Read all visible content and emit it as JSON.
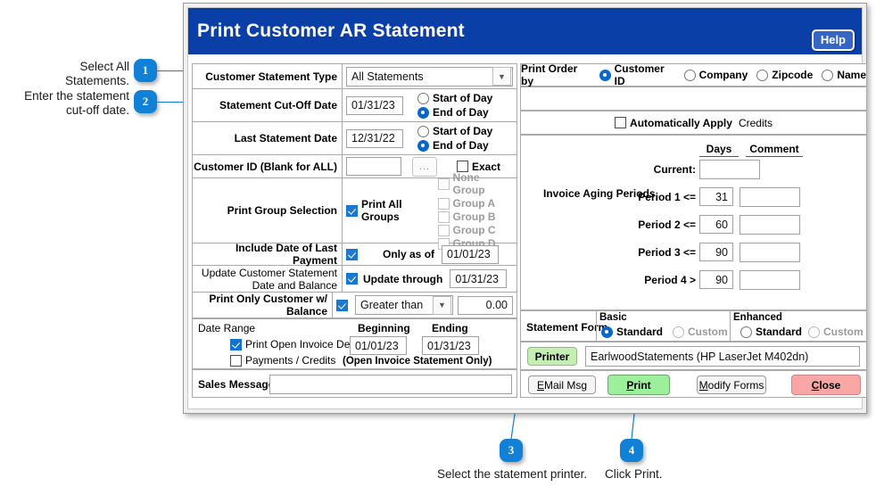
{
  "dialog": {
    "title": "Print Customer AR Statement",
    "help_label": "Help"
  },
  "left_form": {
    "statement_type": {
      "label": "Customer Statement Type",
      "value": "All Statements"
    },
    "cutoff_date": {
      "label": "Statement Cut-Off Date",
      "value": "01/31/23",
      "start_label": "Start of Day",
      "end_label": "End of Day"
    },
    "last_statement_date": {
      "label": "Last Statement Date",
      "value": "12/31/22",
      "start_label": "Start of Day",
      "end_label": "End of Day"
    },
    "customer_id": {
      "label": "Customer ID (Blank for ALL)",
      "value": "",
      "browse_label": "...",
      "exact_label": "Exact"
    },
    "group_selection": {
      "label": "Print Group Selection",
      "print_all_label": "Print All Groups",
      "groups": [
        "None Group",
        "Group A",
        "Group B",
        "Group C",
        "Group D"
      ]
    },
    "last_payment": {
      "label": "Include Date of Last Payment",
      "only_as_of_label": "Only as of",
      "value": "01/01/23"
    },
    "update_statement": {
      "label_line1": "Update Customer Statement",
      "label_line2": "Date and Balance",
      "update_through_label": "Update through",
      "value": "01/31/23"
    },
    "balance_filter": {
      "label": "Print Only Customer w/ Balance",
      "operator": "Greater than",
      "amount": "0.00"
    },
    "date_range": {
      "title": "Date Range",
      "open_invoice_label": "Print Open Invoice Detail",
      "payments_credits_label": "Payments / Credits",
      "beginning_header": "Beginning",
      "ending_header": "Ending",
      "beginning_value": "01/01/23",
      "ending_value": "01/31/23",
      "note": "(Open Invoice Statement Only)"
    },
    "sales_message": {
      "label": "Sales Message",
      "value": ""
    }
  },
  "right_form": {
    "print_order": {
      "label": "Print Order by",
      "options": [
        "Customer ID",
        "Company",
        "Zipcode",
        "Name"
      ],
      "selected": "Customer ID"
    },
    "auto_apply": {
      "bold_label": "Automatically Apply",
      "plain_label": "Credits"
    },
    "aging": {
      "label": "Invoice Aging Periods",
      "days_header": "Days",
      "comment_header": "Comment",
      "rows": [
        {
          "name": "Current:",
          "days": ""
        },
        {
          "name": "Period 1 <=",
          "days": "31"
        },
        {
          "name": "Period 2 <=",
          "days": "60"
        },
        {
          "name": "Period 3 <=",
          "days": "90"
        },
        {
          "name": "Period 4 >",
          "days": "90"
        }
      ]
    },
    "statement_form": {
      "label": "Statement Form",
      "basic_header": "Basic",
      "enhanced_header": "Enhanced",
      "basic_standard": "Standard",
      "basic_custom": "Custom",
      "enhanced_standard": "Standard",
      "enhanced_custom": "Custom"
    },
    "printer": {
      "button_label": "Printer",
      "value": "EarlwoodStatements (HP LaserJet M402dn)"
    },
    "actions": {
      "email": "EMail Msg",
      "print": "Print",
      "modify": "Modify Forms",
      "close": "Close"
    }
  },
  "annotations": [
    {
      "number": "1",
      "text": "Select All Statements."
    },
    {
      "number": "2",
      "text_line1": "Enter the statement",
      "text_line2": "cut-off date."
    },
    {
      "number": "3",
      "text": "Select the statement printer."
    },
    {
      "number": "4",
      "text": "Click Print."
    }
  ],
  "colors": {
    "title_bar": "#0b3fa8",
    "accent": "#1181d8",
    "print_button": "#9cf09c",
    "close_button": "#f8a6a6"
  }
}
